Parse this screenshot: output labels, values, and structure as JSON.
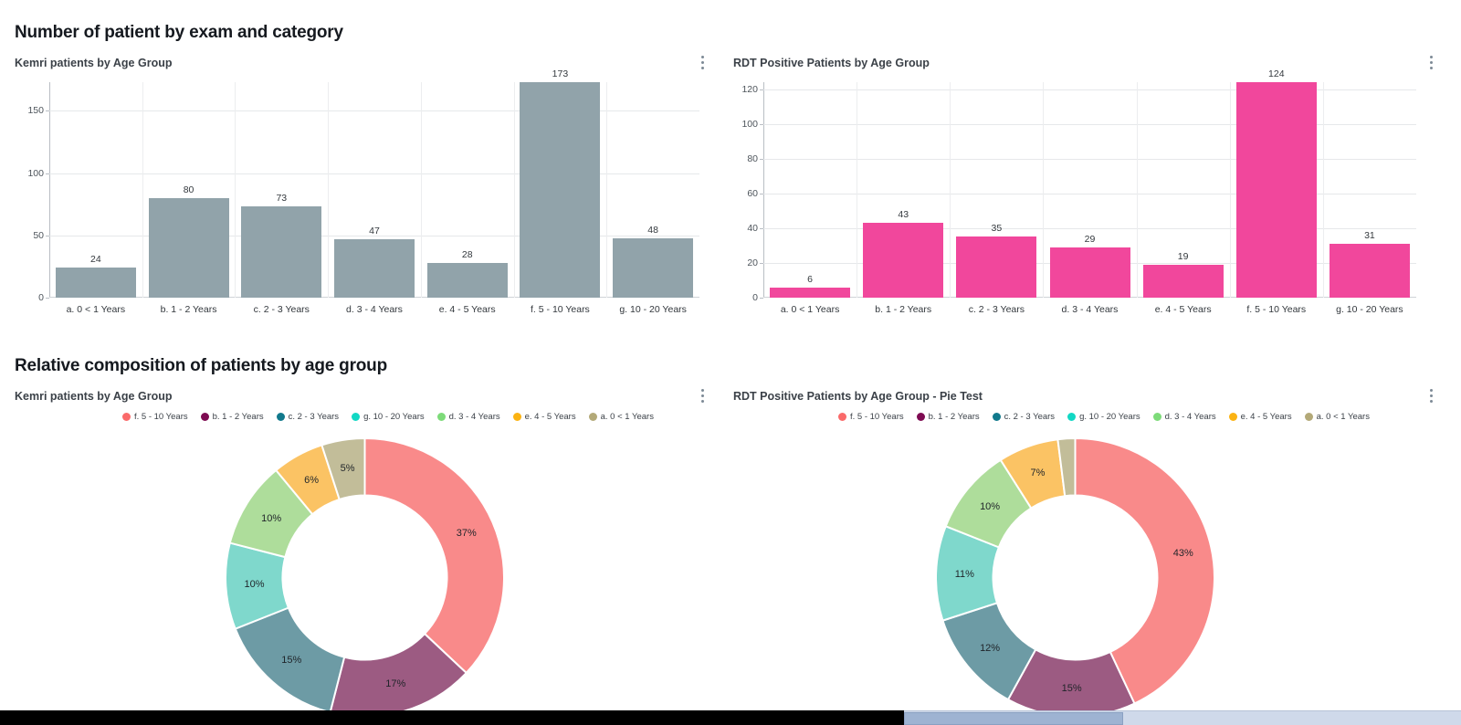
{
  "sections": [
    {
      "title": "Number of patient by exam and category"
    },
    {
      "title": "Relative composition of patients by age group"
    }
  ],
  "panels": {
    "kemri_bar": {
      "title": "Kemri patients by Age Group",
      "menu": "kebab-menu"
    },
    "rdt_bar": {
      "title": "RDT Positive Patients by Age Group",
      "menu": "kebab-menu"
    },
    "kemri_pie": {
      "title": "Kemri patients by Age Group",
      "menu": "kebab-menu"
    },
    "rdt_pie": {
      "title": "RDT Positive Patients by Age Group - Pie Test",
      "menu": "kebab-menu"
    }
  },
  "colors": {
    "kemri_bar": "#91a3aa",
    "rdt_bar": "#f1479c",
    "slice_f": "#f98a8a",
    "slice_b": "#9c5b82",
    "slice_c": "#6d9ba5",
    "slice_g": "#7fd8cc",
    "slice_d": "#aedd9b",
    "slice_e": "#fbc364",
    "slice_a": "#c2bd99",
    "legend_f": "#fa6a6a",
    "legend_b": "#7e0b52",
    "legend_c": "#11798c",
    "legend_g": "#12d8c4",
    "legend_d": "#7ddb79",
    "legend_e": "#fbb313",
    "legend_a": "#b3a978"
  },
  "chart_data": [
    {
      "id": "kemri_bar",
      "type": "bar",
      "title": "Kemri patients by Age Group",
      "categories": [
        "a. 0 < 1 Years",
        "b. 1 - 2 Years",
        "c. 2 - 3 Years",
        "d. 3 - 4 Years",
        "e. 4 - 5 Years",
        "f. 5 - 10 Years",
        "g. 10 - 20 Years"
      ],
      "values": [
        24,
        80,
        73,
        47,
        28,
        173,
        48
      ],
      "value_labels": [
        "24",
        "80",
        "73",
        "47",
        "28",
        "173",
        "48"
      ],
      "yticks": [
        0,
        50,
        100,
        150
      ],
      "ytick_labels": [
        "0",
        "50",
        "100",
        "150"
      ],
      "ylim": [
        0,
        173
      ],
      "xlabel": "",
      "ylabel": "",
      "grid": true,
      "legend": "none",
      "color": "#91a3aa"
    },
    {
      "id": "rdt_bar",
      "type": "bar",
      "title": "RDT Positive Patients by Age Group",
      "categories": [
        "a. 0 < 1 Years",
        "b. 1 - 2 Years",
        "c. 2 - 3 Years",
        "d. 3 - 4 Years",
        "e. 4 - 5 Years",
        "f. 5 - 10 Years",
        "g. 10 - 20 Years"
      ],
      "values": [
        6,
        43,
        35,
        29,
        19,
        124,
        31
      ],
      "value_labels": [
        "6",
        "43",
        "35",
        "29",
        "19",
        "124",
        "31"
      ],
      "yticks": [
        0,
        20,
        40,
        60,
        80,
        100,
        120
      ],
      "ytick_labels": [
        "0",
        "20",
        "40",
        "60",
        "80",
        "100",
        "120"
      ],
      "ylim": [
        0,
        124
      ],
      "xlabel": "",
      "ylabel": "",
      "grid": true,
      "legend": "none",
      "color": "#f1479c"
    },
    {
      "id": "kemri_pie",
      "type": "pie",
      "title": "Kemri patients by Age Group",
      "legend_position": "top",
      "labels": [
        "f. 5 - 10 Years",
        "b. 1 - 2 Years",
        "c. 2 - 3 Years",
        "g. 10 - 20 Years",
        "d. 3 - 4 Years",
        "e. 4 - 5 Years",
        "a. 0 < 1 Years"
      ],
      "values": [
        37,
        17,
        15,
        10,
        10,
        6,
        5
      ],
      "value_labels": [
        "37%",
        "17%",
        "15%",
        "10%",
        "10%",
        "6%",
        "5%"
      ],
      "colors": [
        "#f98a8a",
        "#9c5b82",
        "#6d9ba5",
        "#7fd8cc",
        "#aedd9b",
        "#fbc364",
        "#c2bd99"
      ]
    },
    {
      "id": "rdt_pie",
      "type": "pie",
      "title": "RDT Positive Patients by Age Group - Pie Test",
      "legend_position": "top",
      "labels": [
        "f. 5 - 10 Years",
        "b. 1 - 2 Years",
        "c. 2 - 3 Years",
        "g. 10 - 20 Years",
        "d. 3 - 4 Years",
        "e. 4 - 5 Years",
        "a. 0 < 1 Years"
      ],
      "values": [
        43,
        15,
        12,
        11,
        10,
        7,
        2
      ],
      "value_labels": [
        "43%",
        "15%",
        "12%",
        "11%",
        "10%",
        "7%",
        ""
      ],
      "colors": [
        "#f98a8a",
        "#9c5b82",
        "#6d9ba5",
        "#7fd8cc",
        "#aedd9b",
        "#fbc364",
        "#c2bd99"
      ]
    }
  ],
  "legend_items": [
    {
      "label": "f. 5 - 10 Years",
      "color": "#fa6a6a"
    },
    {
      "label": "b. 1 - 2 Years",
      "color": "#7e0b52"
    },
    {
      "label": "c. 2 - 3 Years",
      "color": "#11798c"
    },
    {
      "label": "g. 10 - 20 Years",
      "color": "#12d8c4"
    },
    {
      "label": "d. 3 - 4 Years",
      "color": "#7ddb79"
    },
    {
      "label": "e. 4 - 5 Years",
      "color": "#fbb313"
    },
    {
      "label": "a. 0 < 1 Years",
      "color": "#b3a978"
    }
  ]
}
